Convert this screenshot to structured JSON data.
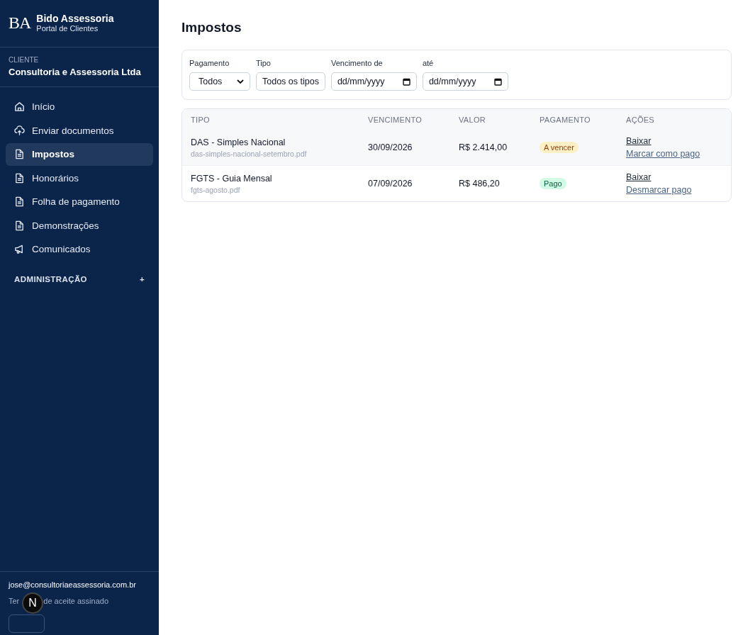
{
  "brand": {
    "logo": "BA",
    "name": "Bido Assessoria",
    "subtitle": "Portal de Clientes"
  },
  "client": {
    "label": "CLIENTE",
    "name": "Consultoria e Assessoria Ltda"
  },
  "nav": [
    {
      "label": "Início",
      "kind": "home",
      "selected": false
    },
    {
      "label": "Enviar documentos",
      "kind": "upload",
      "selected": false
    },
    {
      "label": "Impostos",
      "kind": "doc",
      "selected": true
    },
    {
      "label": "Honorários",
      "kind": "doc",
      "selected": false
    },
    {
      "label": "Folha de pagamento",
      "kind": "doc",
      "selected": false
    },
    {
      "label": "Demonstrações",
      "kind": "doc",
      "selected": false
    },
    {
      "label": "Comunicados",
      "kind": "megaphone",
      "selected": false
    }
  ],
  "admin": {
    "label": "ADMINISTRAÇÃO",
    "toggle": "+"
  },
  "footer": {
    "email": "jose@consultoriaeassessoria.com.br",
    "terms": [
      "Ter",
      "de aceite assinado"
    ],
    "badge": "N"
  },
  "page_title": "Impostos",
  "filters": [
    {
      "kind": "select",
      "label": "Pagamento",
      "value": "Todos"
    },
    {
      "kind": "text",
      "label": "Tipo",
      "value": "Todos os tipos"
    },
    {
      "kind": "date",
      "label": "Vencimento de",
      "placeholder": "dd/mm/yyyy"
    },
    {
      "kind": "date",
      "label": "até",
      "placeholder": "dd/mm/yyyy"
    }
  ],
  "table": {
    "columns": [
      "TIPO",
      "VENCIMENTO",
      "VALOR",
      "PAGAMENTO",
      "AÇÕES"
    ],
    "rows": [
      {
        "title": "DAS - Simples Nacional",
        "file": "das-simples-nacional-setembro.pdf",
        "due": "30/09/2026",
        "value": "R$ 2.414,00",
        "status": "A vencer",
        "kind": "pending",
        "highlighted": true,
        "actions": [
          "Baixar",
          "Marcar como pago"
        ]
      },
      {
        "title": "FGTS - Guia Mensal",
        "file": "fgts-agosto.pdf",
        "due": "07/09/2026",
        "value": "R$ 486,20",
        "status": "Pago",
        "kind": "paid",
        "highlighted": false,
        "actions": [
          "Baixar",
          "Desmarcar pago"
        ]
      }
    ]
  }
}
